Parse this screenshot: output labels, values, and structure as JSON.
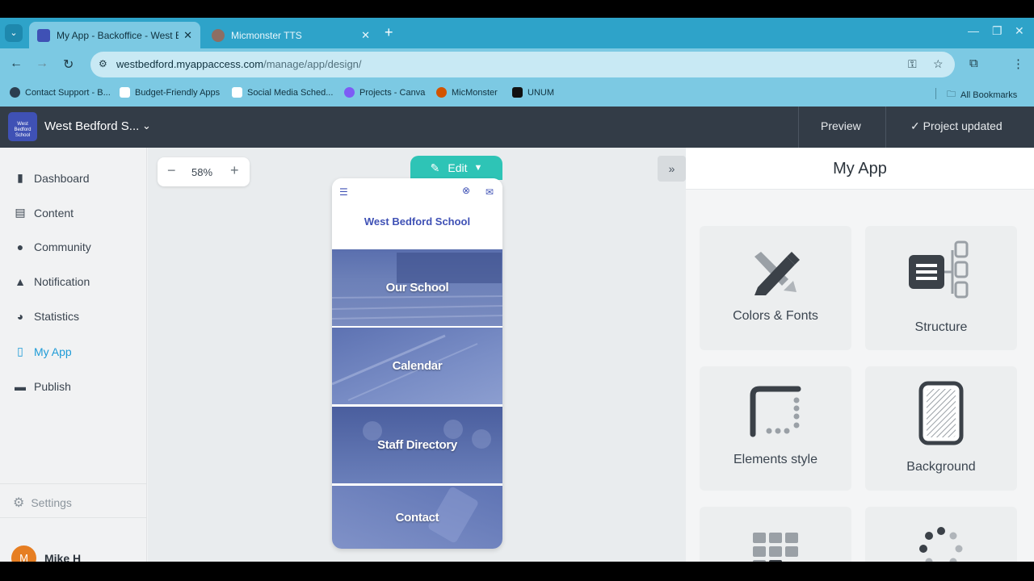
{
  "browser": {
    "tabs": [
      {
        "title": "My App - Backoffice - West Bed",
        "active": true
      },
      {
        "title": "Micmonster TTS",
        "active": false
      }
    ],
    "url_domain": "westbedford.myappaccess.com",
    "url_path": "/manage/app/design/",
    "bookmarks": [
      {
        "label": "Contact Support - B...",
        "color": "#2c3e50"
      },
      {
        "label": "Budget-Friendly Apps",
        "color": "#ffffff"
      },
      {
        "label": "Social Media Sched...",
        "color": "#ffffff"
      },
      {
        "label": "Projects - Canva",
        "color": "#7d5cf5"
      },
      {
        "label": "MicMonster",
        "color": "#d35400"
      },
      {
        "label": "UNUM",
        "color": "#111111"
      }
    ],
    "all_bookmarks": "All Bookmarks"
  },
  "app": {
    "logo_text": "West Bedford School",
    "name": "West Bedford S...",
    "preview": "Preview",
    "project_status": "Project updated"
  },
  "sidebar": {
    "items": [
      {
        "label": "Dashboard",
        "icon": "bar-chart-icon"
      },
      {
        "label": "Content",
        "icon": "document-icon"
      },
      {
        "label": "Community",
        "icon": "person-icon"
      },
      {
        "label": "Notification",
        "icon": "bell-icon"
      },
      {
        "label": "Statistics",
        "icon": "pie-chart-icon"
      },
      {
        "label": "My App",
        "icon": "phone-icon"
      },
      {
        "label": "Publish",
        "icon": "store-icon"
      }
    ],
    "settings": "Settings",
    "user": {
      "initial": "M",
      "name": "Mike H"
    }
  },
  "canvas": {
    "zoom": "58%",
    "edit": "Edit",
    "phone_title": "West Bedford School",
    "tiles": [
      "Our School",
      "Calendar",
      "Staff Directory",
      "Contact"
    ]
  },
  "panel": {
    "title": "My App",
    "cards": [
      "Colors & Fonts",
      "Structure",
      "Elements style",
      "Background"
    ]
  },
  "colors": {
    "chrome": "#2ea3c9",
    "header": "#333c47",
    "accent": "#1e9bd7",
    "edit": "#2ec4b6",
    "brand": "#3f51b5"
  }
}
